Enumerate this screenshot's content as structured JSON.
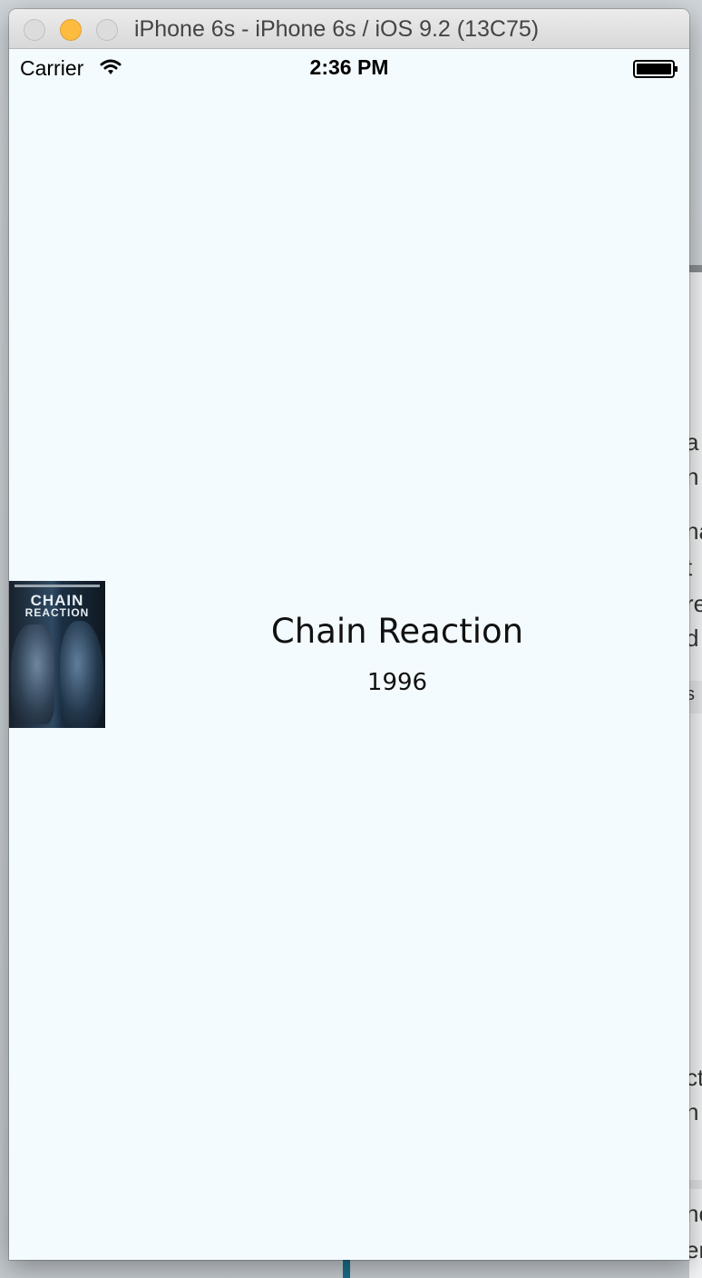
{
  "window": {
    "title": "iPhone 6s - iPhone 6s / iOS 9.2 (13C75)"
  },
  "status_bar": {
    "carrier": "Carrier",
    "time": "2:36 PM",
    "icons": [
      "wifi-icon",
      "battery-icon"
    ]
  },
  "movie": {
    "title": "Chain Reaction",
    "year": "1996",
    "poster": {
      "title_line1": "CHAIN",
      "title_line2": "REACTION"
    }
  },
  "background_fragments": [
    "a",
    "n",
    "na",
    "t",
    "re",
    "d",
    "s",
    "ct",
    "n",
    "nc",
    "er"
  ],
  "colors": {
    "screen_background": "#f4fbfe",
    "minimize_button": "#fdbb40"
  }
}
